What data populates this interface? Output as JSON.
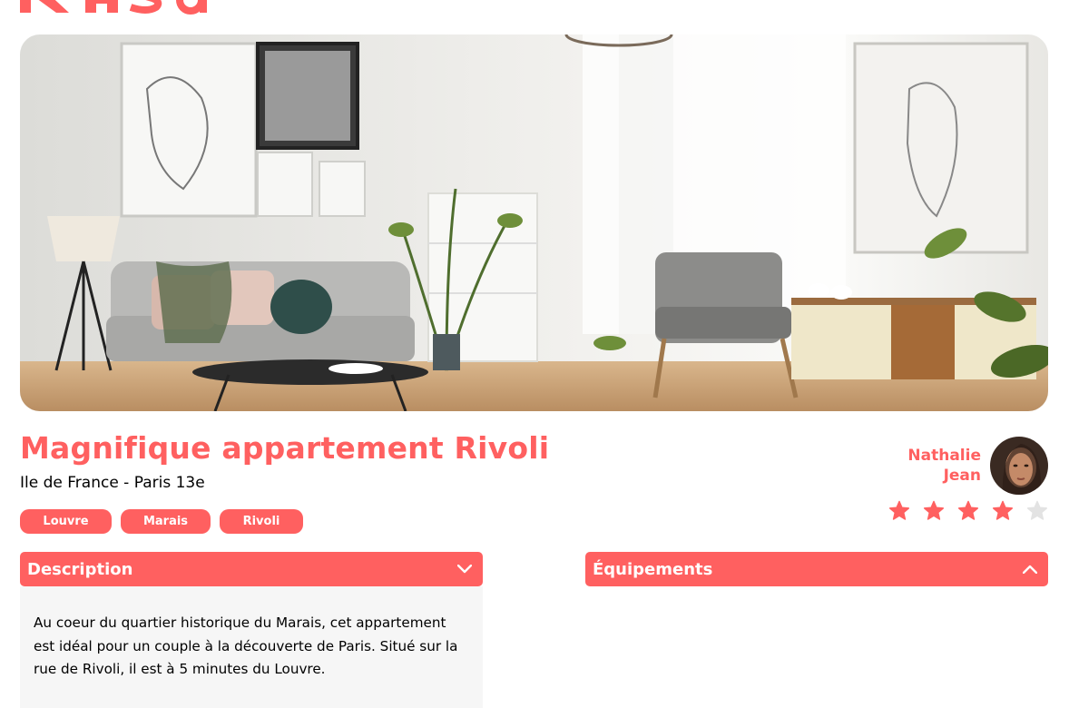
{
  "logo": {
    "text": "Kasa",
    "color": "#FF6060"
  },
  "hero": {
    "alt": "living-room-photo"
  },
  "listing": {
    "title": "Magnifique appartement Rivoli",
    "location": "Ile de France - Paris 13e",
    "tags": [
      "Louvre",
      "Marais",
      "Rivoli"
    ]
  },
  "host": {
    "first_name": "Nathalie",
    "last_name": "Jean"
  },
  "rating": {
    "value": 4,
    "max": 5,
    "active_color": "#FF6060",
    "inactive_color": "#E3E3E3"
  },
  "collapses": {
    "description": {
      "title": "Description",
      "expanded": true,
      "text": "Au coeur du quartier historique du Marais, cet appartement est idéal pour un couple à la découverte de Paris. Situé sur la rue de Rivoli, il est à 5 minutes du Louvre."
    },
    "equipments": {
      "title": "Équipements",
      "expanded": false
    }
  },
  "colors": {
    "accent": "#FF6060",
    "panel_bg": "#F6F6F6"
  }
}
